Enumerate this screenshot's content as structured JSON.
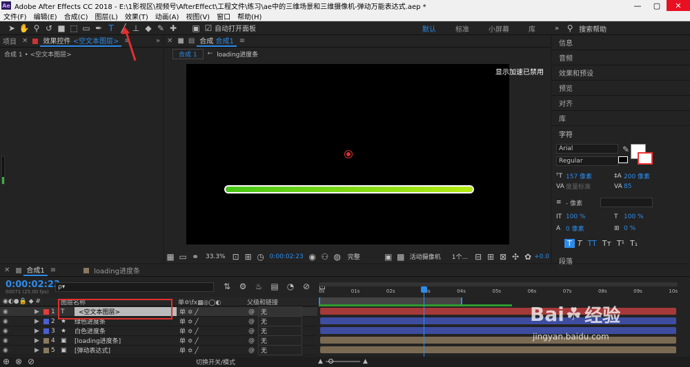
{
  "window": {
    "app_title": "Adobe After Effects CC 2018 - E:\\1影视区\\视频号\\AfterEffect\\工程文件\\练习\\ae中的三维场景和三维摄像机-弹动万能表达式.aep *",
    "min": "—",
    "max": "▢",
    "close": "✕"
  },
  "menu": [
    "文件(F)",
    "编辑(E)",
    "合成(C)",
    "图层(L)",
    "效果(T)",
    "动画(A)",
    "视图(V)",
    "窗口",
    "帮助(H)"
  ],
  "toolbar": {
    "auto_open": "自动打开面板",
    "workspaces": [
      "默认",
      "标准",
      "小屏幕",
      "库"
    ],
    "search_placeholder": "搜索帮助",
    "more": "»"
  },
  "left_panel": {
    "tab_project": "项目",
    "tab_effects_prefix": "效果控件",
    "tab_effects_layer": "<空文本图层>",
    "breadcrumb": "合成 1 • <空文本图层>",
    "more": "»"
  },
  "viewer": {
    "tab_label": "合成",
    "comp_name": "合成1",
    "sub_tab_active": "合成 1",
    "sub_tab_other": "loading进度条",
    "accel_notice": "显示加速已禁用",
    "zoom": "33.3%",
    "timecode": "0:00:02:23",
    "quality": "完整",
    "camera": "活动摄像机",
    "views": "1个...",
    "exposure": "+0.0"
  },
  "progress_bar": {
    "fill_fraction": 1.0,
    "color_start": "#45c517",
    "color_end": "#b5ea12"
  },
  "right_panel": {
    "items": [
      "信息",
      "音频",
      "效果和预设",
      "预览",
      "对齐",
      "库"
    ],
    "char_title": "字符",
    "font": "Arial",
    "style": "Regular",
    "size": "157 像素",
    "leading": "200 像素",
    "kerning": "度量标准",
    "tracking": "85",
    "stroke_width": "- 像素",
    "vscale": "100 %",
    "hscale": "100 %",
    "baseline": "0 像素",
    "tsume": "0 %",
    "style_buttons": [
      "T",
      "T",
      "TT",
      "Tт",
      "T¹",
      "T₁"
    ],
    "paragraph": "段落"
  },
  "timeline": {
    "tab_comp": "合成1",
    "tab_other": "loading进度条",
    "timecode": "0:00:02:23",
    "timecode_sub": "00071 (25.00 fps)",
    "search_placeholder": "ρ▾",
    "col_layer_name": "图层名称",
    "col_parent": "父级和链接",
    "ruler": [
      "0s",
      "01s",
      "02s",
      "03s",
      "04s",
      "05s",
      "06s",
      "07s",
      "08s",
      "09s",
      "10s"
    ],
    "layers": [
      {
        "num": "1",
        "type": "T",
        "name": "<空文本图层>",
        "color": "#e33c3c",
        "parent": "无",
        "bar": "#a63a3a"
      },
      {
        "num": "2",
        "type": "★",
        "name": "绿色进度条",
        "color": "#4a5fd0",
        "parent": "无",
        "bar": "#3f4da0"
      },
      {
        "num": "3",
        "type": "★",
        "name": "白色进度条",
        "color": "#4a5fd0",
        "parent": "无",
        "bar": "#3f4da0"
      },
      {
        "num": "4",
        "type": "▣",
        "name": "[loading进度条]",
        "color": "#8a7a5e",
        "parent": "无",
        "bar": "#7a6a52"
      },
      {
        "num": "5",
        "type": "▣",
        "name": "[弹动表达式]",
        "color": "#8a7a5e",
        "parent": "无",
        "bar": "#7a6a52"
      }
    ],
    "footer": "切换开关/模式"
  },
  "watermark": {
    "brand": "Bai",
    "logo_cn": "经验",
    "url": "jingyan.baidu.com"
  }
}
